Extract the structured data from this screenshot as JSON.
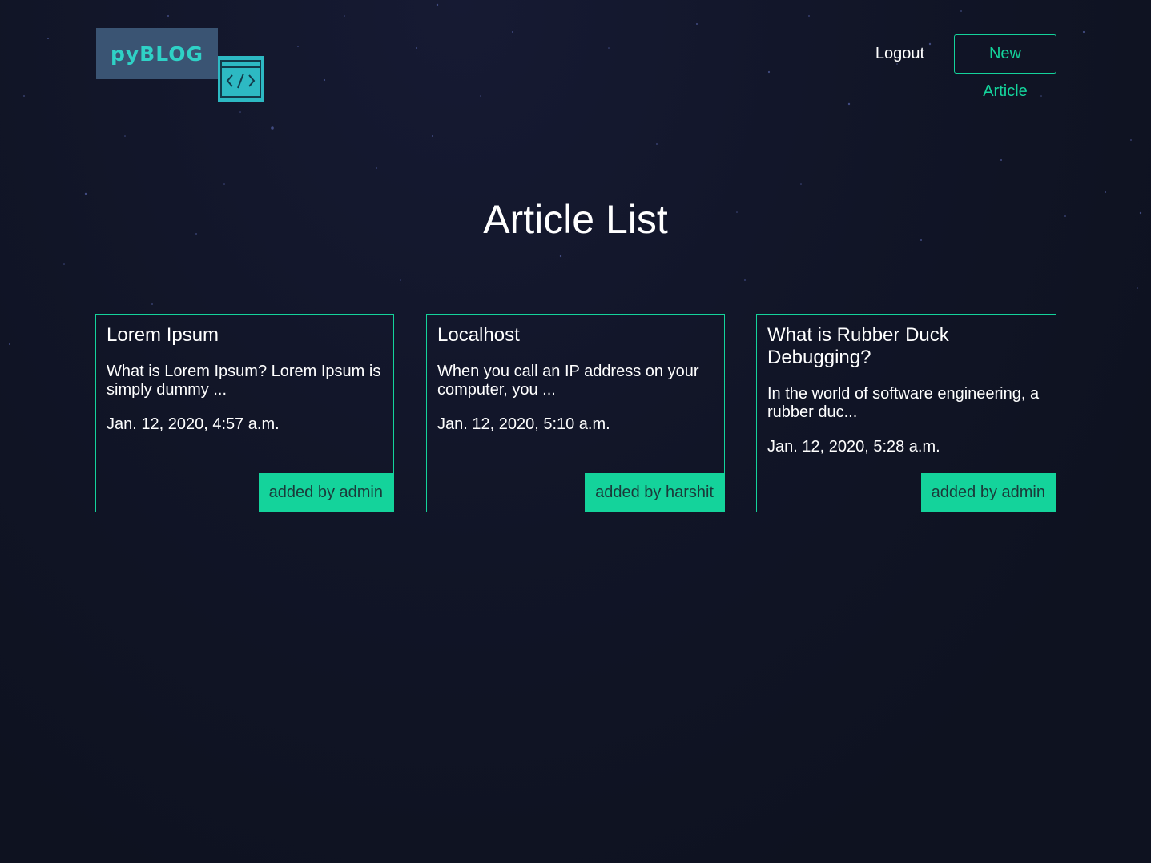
{
  "header": {
    "logo_text": "pyBLOG",
    "logout_label": "Logout",
    "new_article_label": "New Article"
  },
  "main": {
    "title": "Article List",
    "articles": [
      {
        "title": "Lorem Ipsum",
        "snippet": "What is Lorem Ipsum? Lorem Ipsum is simply dummy ...",
        "date": "Jan. 12, 2020, 4:57 a.m.",
        "author_label": "added by admin"
      },
      {
        "title": "Localhost",
        "snippet": "When you call an IP address on your computer, you ...",
        "date": "Jan. 12, 2020, 5:10 a.m.",
        "author_label": "added by harshit"
      },
      {
        "title": "What is Rubber Duck Debugging?",
        "snippet": "In the world of software engineering, a rubber duc...",
        "date": "Jan. 12, 2020, 5:28 a.m.",
        "author_label": "added by admin"
      }
    ]
  },
  "colors": {
    "background": "#0e1220",
    "accent": "#14d39b",
    "logo_box": "#3a5473",
    "logo_text": "#2fd1c6",
    "logo_code": "#2db9c3"
  },
  "icons": {
    "logo_code": "code-brackets-icon"
  }
}
